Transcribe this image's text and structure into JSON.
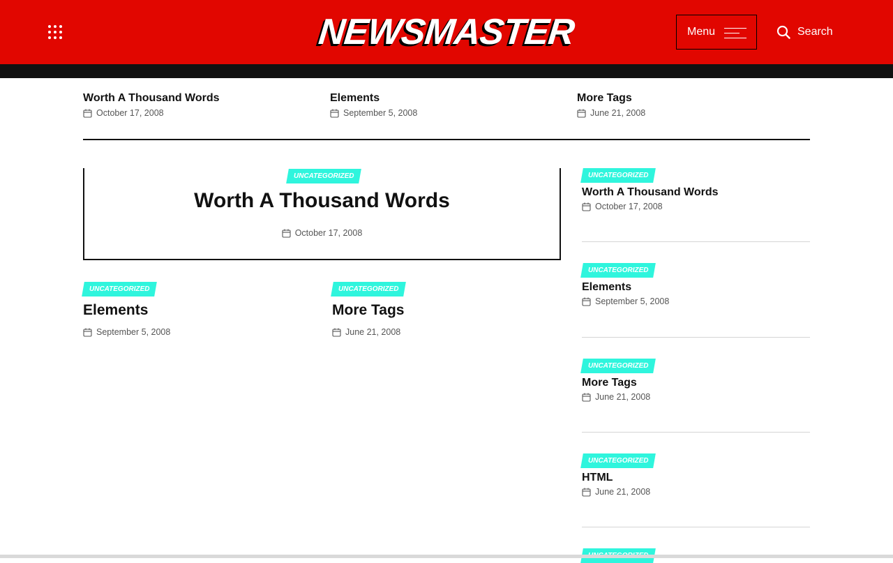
{
  "header": {
    "logo": "NEWSMASTER",
    "menu_label": "Menu",
    "search_label": "Search"
  },
  "colors": {
    "header_bg": "#e10600",
    "tag_bg": "#2ff5dd",
    "bar_bg": "#111111"
  },
  "icons": {
    "grid": "grid-dots-icon",
    "menu": "hamburger-icon",
    "search": "search-icon",
    "date": "calendar-icon"
  },
  "top_strip": [
    {
      "title": "Worth A Thousand Words",
      "date": "October 17, 2008"
    },
    {
      "title": "Elements",
      "date": "September 5, 2008"
    },
    {
      "title": "More Tags",
      "date": "June 21, 2008"
    }
  ],
  "featured": {
    "category": "UNCATEGORIZED",
    "title": "Worth A Thousand Words",
    "date": "October 17, 2008"
  },
  "grid_posts": [
    {
      "category": "UNCATEGORIZED",
      "title": "Elements",
      "date": "September 5, 2008"
    },
    {
      "category": "UNCATEGORIZED",
      "title": "More Tags",
      "date": "June 21, 2008"
    }
  ],
  "sidebar": [
    {
      "category": "UNCATEGORIZED",
      "title": "Worth A Thousand Words",
      "date": "October 17, 2008"
    },
    {
      "category": "UNCATEGORIZED",
      "title": "Elements",
      "date": "September 5, 2008"
    },
    {
      "category": "UNCATEGORIZED",
      "title": "More Tags",
      "date": "June 21, 2008"
    },
    {
      "category": "UNCATEGORIZED",
      "title": "HTML",
      "date": "June 21, 2008"
    },
    {
      "category": "UNCATEGORIZED"
    }
  ]
}
